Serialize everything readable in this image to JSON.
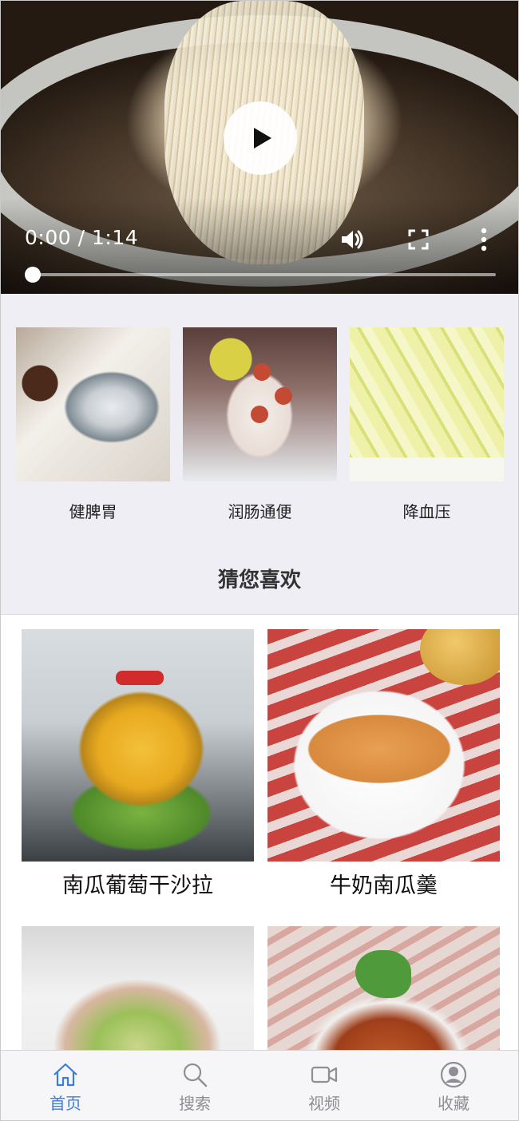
{
  "video": {
    "current_time": "0:00",
    "separator": "/",
    "duration": "1:14",
    "progress": 0,
    "controls": [
      "play-icon",
      "volume-icon",
      "fullscreen-icon",
      "more-vertical-icon"
    ]
  },
  "categories": [
    {
      "label": "健脾胃"
    },
    {
      "label": "润肠通便"
    },
    {
      "label": "降血压"
    }
  ],
  "recommend": {
    "title": "猜您喜欢"
  },
  "recipes": [
    {
      "name": "南瓜葡萄干沙拉"
    },
    {
      "name": "牛奶南瓜羹"
    },
    {
      "name": ""
    },
    {
      "name": ""
    }
  ],
  "tabbar": {
    "items": [
      {
        "label": "首页",
        "icon": "home-icon",
        "active": true
      },
      {
        "label": "搜索",
        "icon": "search-icon",
        "active": false
      },
      {
        "label": "视频",
        "icon": "video-camera-icon",
        "active": false
      },
      {
        "label": "收藏",
        "icon": "user-icon",
        "active": false
      }
    ],
    "active_color": "#3b7ddd",
    "inactive_color": "#8e8e93"
  }
}
